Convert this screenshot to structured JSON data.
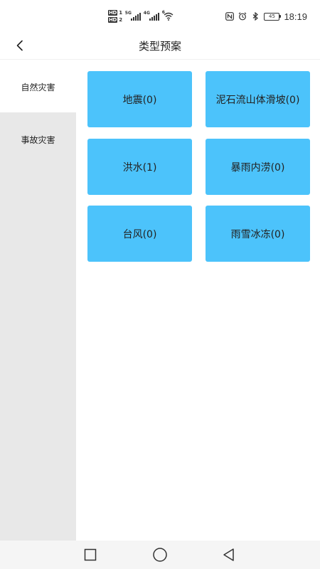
{
  "status_bar": {
    "hd1": "HD",
    "hd1_num": "1",
    "hd2": "HD",
    "hd2_num": "2",
    "net1": "5G",
    "net2": "4G",
    "wifi_num": "6",
    "battery": "45",
    "time": "18:19",
    "icons": [
      "nfc-icon",
      "alarm-icon",
      "bluetooth-icon"
    ]
  },
  "header": {
    "title": "类型预案",
    "back_icon": "chevron-left-icon"
  },
  "sidebar": {
    "items": [
      {
        "label": "自然灾害",
        "active": true
      },
      {
        "label": "事故灾害",
        "active": false
      }
    ]
  },
  "grid": {
    "cards": [
      {
        "label": "地震(0)"
      },
      {
        "label": "泥石流山体滑坡(0)"
      },
      {
        "label": "洪水(1)"
      },
      {
        "label": "暴雨内涝(0)"
      },
      {
        "label": "台风(0)"
      },
      {
        "label": "雨雪冰冻(0)"
      }
    ]
  },
  "colors": {
    "card": "#4cc3fb",
    "sidebar_bg": "#e8e8e8",
    "active_bg": "#ffffff"
  },
  "navbar": {
    "icons": [
      "recent-apps-icon",
      "home-icon",
      "back-icon"
    ]
  }
}
